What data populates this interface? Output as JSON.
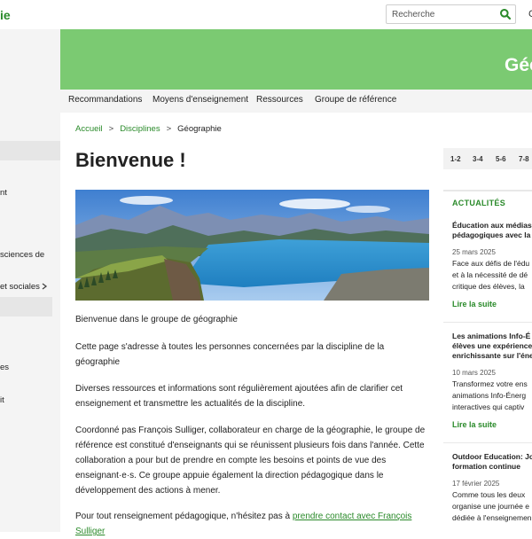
{
  "header": {
    "site_title": "ie",
    "search_placeholder": "Recherche",
    "right_cut": "C"
  },
  "banner": {
    "title": "Géo"
  },
  "sidebar": {
    "items": [
      {
        "label": "nt"
      },
      {
        "label": "sciences de"
      },
      {
        "label": "et sociales"
      },
      {
        "label": "es"
      },
      {
        "label": "it"
      }
    ]
  },
  "tabs": [
    {
      "label": "Recommandations"
    },
    {
      "label": "Moyens d'enseignement"
    },
    {
      "label": "Ressources"
    },
    {
      "label": "Groupe de référence"
    }
  ],
  "breadcrumb": {
    "home": "Accueil",
    "sep": ">",
    "section": "Disciplines",
    "current": "Géographie"
  },
  "page_title": "Bienvenue !",
  "levels": [
    "1-2",
    "3-4",
    "5-6",
    "7-8"
  ],
  "content": {
    "p1": "Bienvenue dans le groupe de géographie",
    "p2": "Cette page s'adresse à toutes les personnes concernées par la discipline de la géographie",
    "p3": "Diverses ressources et informations sont régulièrement ajoutées afin de clarifier cet enseignement et transmettre les actualités de la discipline.",
    "p4": "Coordonné pas François Sulliger, collaborateur en charge de la géographie, le groupe de référence est constitué d'enseignants qui se réunissent plusieurs fois dans l'année. Cette collaboration a pour but de prendre en compte les besoins et points de vue des enseignant·e·s. Ce groupe appuie également la direction pédagogique dans le développement des actions à mener.",
    "p5_text": "Pour tout renseignement pédagogique, n'hésitez pas à ",
    "p5_link": "prendre contact avec François Sulliger"
  },
  "news": {
    "heading": "ACTUALITÉS",
    "items": [
      {
        "title_1": "Éducation aux médias",
        "title_2": "pédagogiques avec la",
        "date": "25 mars 2025",
        "text_1": "Face aux défis de l'édu",
        "text_2": "et à la nécessité de dé",
        "text_3": "critique des élèves, la",
        "link": "Lire la suite"
      },
      {
        "title_1": "Les animations Info-É",
        "title_2": "élèves une expérience",
        "title_3": "enrichissante sur l'éne",
        "date": "10 mars 2025",
        "text_1": "Transformez votre ens",
        "text_2": "animations Info-Énerg",
        "text_3": "interactives qui captiv",
        "link": "Lire la suite"
      },
      {
        "title_1": "Outdoor Education: Jo",
        "title_2": "formation continue",
        "date": "17 février 2025",
        "text_1": "Comme tous les deux",
        "text_2": "organise une journée e",
        "text_3": "dédiée à l'enseignemen"
      }
    ]
  }
}
